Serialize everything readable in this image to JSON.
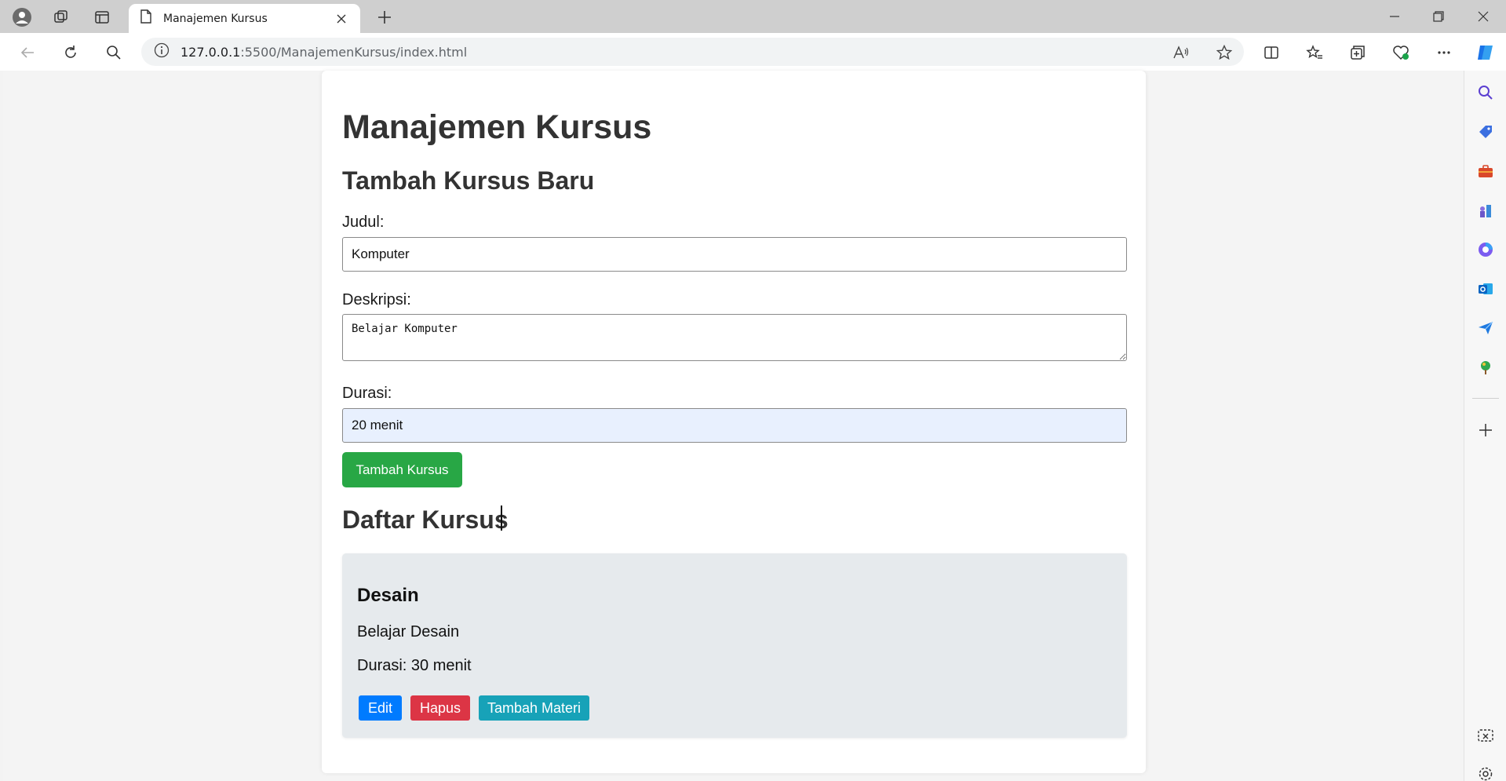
{
  "browser": {
    "tab_title": "Manajemen Kursus",
    "url_host": "127.0.0.1",
    "url_path": ":5500/ManajemenKursus/index.html"
  },
  "page": {
    "title": "Manajemen Kursus",
    "form_heading": "Tambah Kursus Baru",
    "judul_label": "Judul:",
    "judul_value": "Komputer",
    "deskripsi_label": "Deskripsi:",
    "deskripsi_value": "Belajar Komputer",
    "durasi_label": "Durasi:",
    "durasi_value": "20 menit",
    "add_button": "Tambah Kursus",
    "list_heading": "Daftar Kursus",
    "courses": [
      {
        "title": "Desain",
        "description": "Belajar Desain",
        "duration": "Durasi: 30 menit",
        "edit_label": "Edit",
        "delete_label": "Hapus",
        "add_material_label": "Tambah Materi"
      }
    ]
  },
  "colors": {
    "add_button": "#28a745",
    "edit_button": "#007bff",
    "delete_button": "#dc3545",
    "material_button": "#17a2b8",
    "course_card": "#e6eaed"
  }
}
